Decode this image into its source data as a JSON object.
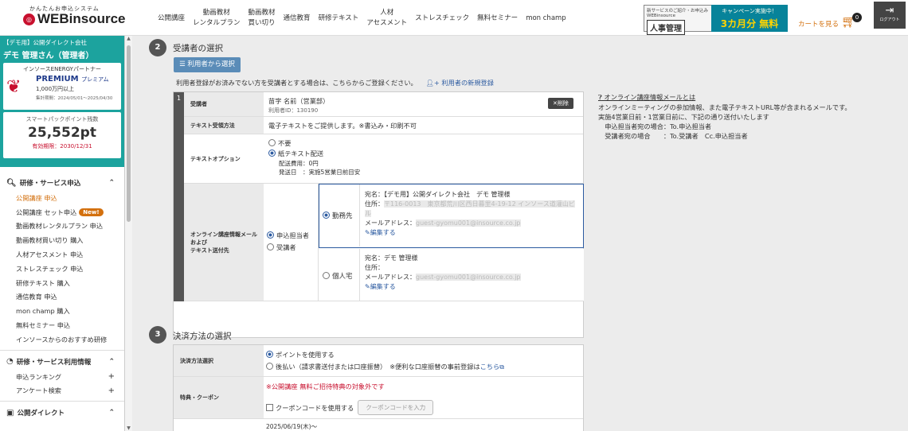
{
  "header": {
    "tagline": "かんたんお申込システム",
    "logo_text": "WEBinsource",
    "nav": [
      "公開講座",
      "動画教材\nレンタルプラン",
      "動画教材\n買い切り",
      "通信教育",
      "研修テキスト",
      "人材\nアセスメント",
      "ストレスチェック",
      "無料セミナー",
      "mon champ"
    ],
    "banner1_small": "新サービスのご紹介・お申込み WEBinsource",
    "banner1_big": "人事管理",
    "banner2_line1": "キャンペーン実施中！",
    "banner2_line2": "3カ月分 無料",
    "cart_label": "カートを見る",
    "cart_count": "0",
    "logout_label": "ログアウト"
  },
  "sidebar": {
    "company": "【デモ用】公開ダイレクト会社",
    "user": "デモ 管理さん（管理者）",
    "partner_l1": "インソースENERGYパートナー",
    "partner_l2": "PREMIUM",
    "partner_l2b": "プレミアム",
    "partner_l3": "1,000万円以上",
    "partner_l4": "集計期間：2024/05/01〜2025/04/30",
    "points_label": "スマートパックポイント残数",
    "points_value": "25,552pt",
    "points_expiry": "有効期限：2030/12/31",
    "section1": "研修・サービス申込",
    "links1": [
      "公開講座 申込",
      "公開講座 セット申込",
      "動画教材レンタルプラン 申込",
      "動画教材買い切り 購入",
      "人材アセスメント 申込",
      "ストレスチェック 申込",
      "研修テキスト 購入",
      "通信教育 申込",
      "mon champ 購入",
      "無料セミナー 申込",
      "インソースからのおすすめ研修"
    ],
    "new_badge": "New!",
    "section2": "研修・サービス利用情報",
    "links2": [
      "申込ランキング",
      "アンケート検索"
    ],
    "section3": "公開ダイレクト"
  },
  "main": {
    "step2_num": "2",
    "step2_title": "受講者の選択",
    "select_user_btn": "利用者から選択",
    "register_note": "利用者登録がお済みでない方を受講者とする場合は、こちらからご登録ください。",
    "register_link": "利用者の新規登録",
    "row_num": "1",
    "labels": {
      "attendee": "受講者",
      "text_method": "テキスト受領方法",
      "text_option": "テキストオプション",
      "online_mail": "オンライン講座情報メール\nおよび\nテキスト送付先"
    },
    "attendee_name": "苗字 名前（営業部）",
    "attendee_id": "利用者ID：130190",
    "delete_btn": "削除",
    "text_method_value": "電子テキストをご提供します。※書込み・印刷不可",
    "opt_none": "不要",
    "opt_paper": "紙テキスト配送",
    "shipping_fee": "配送費用：0円",
    "ship_date": "発送日　：実施5営業日前目安",
    "recipient_applicant": "申込担当者",
    "recipient_attendee": "受講者",
    "dest_work": "勤務先",
    "dest_home": "個人宅",
    "work_name": "宛名：【デモ用】公開ダイレクト会社　デモ 管理様",
    "work_address_label": "住所：",
    "work_address": "〒116-0013　東京都荒川区西日暮里4-19-12 インソース道灌山ビル",
    "work_mail_label": "メールアドレス：",
    "work_mail": "guest-gyomu001@insource.co.jp",
    "edit_link": "編集する",
    "home_name": "宛名：デモ 管理様",
    "home_address_label": "住所：",
    "home_mail_label": "メールアドレス：",
    "home_mail": "guest-gyomu001@insource.co.jp",
    "info_title": "オンライン講座情報メールとは",
    "info_lines": [
      "オンラインミーティングの参加情報、また電子テキストURL等が含まれるメールです。",
      "実施4営業日前・1営業日前に、下記の通り送付いたします",
      "　申込担当者宛の場合：To.申込担当者",
      "　受講者宛の場合　　：To.受講者　Cc.申込担当者"
    ],
    "step3_num": "3",
    "step3_title": "決済方法の選択",
    "pay_label": "決済方法選択",
    "pay_points": "ポイントを使用する",
    "pay_later": "後払い（請求書送付または口座振替）",
    "pay_note": "※便利な口座振替の事前登録は",
    "pay_note_link": "こちら",
    "coupon_label": "特典・クーポン",
    "coupon_warning": "※公開講座 無料ご招待特典の対象外です",
    "coupon_check": "クーポンコードを使用する",
    "coupon_btn": "クーポンコードを入力",
    "date_row": "2025/06/19(木)〜"
  }
}
